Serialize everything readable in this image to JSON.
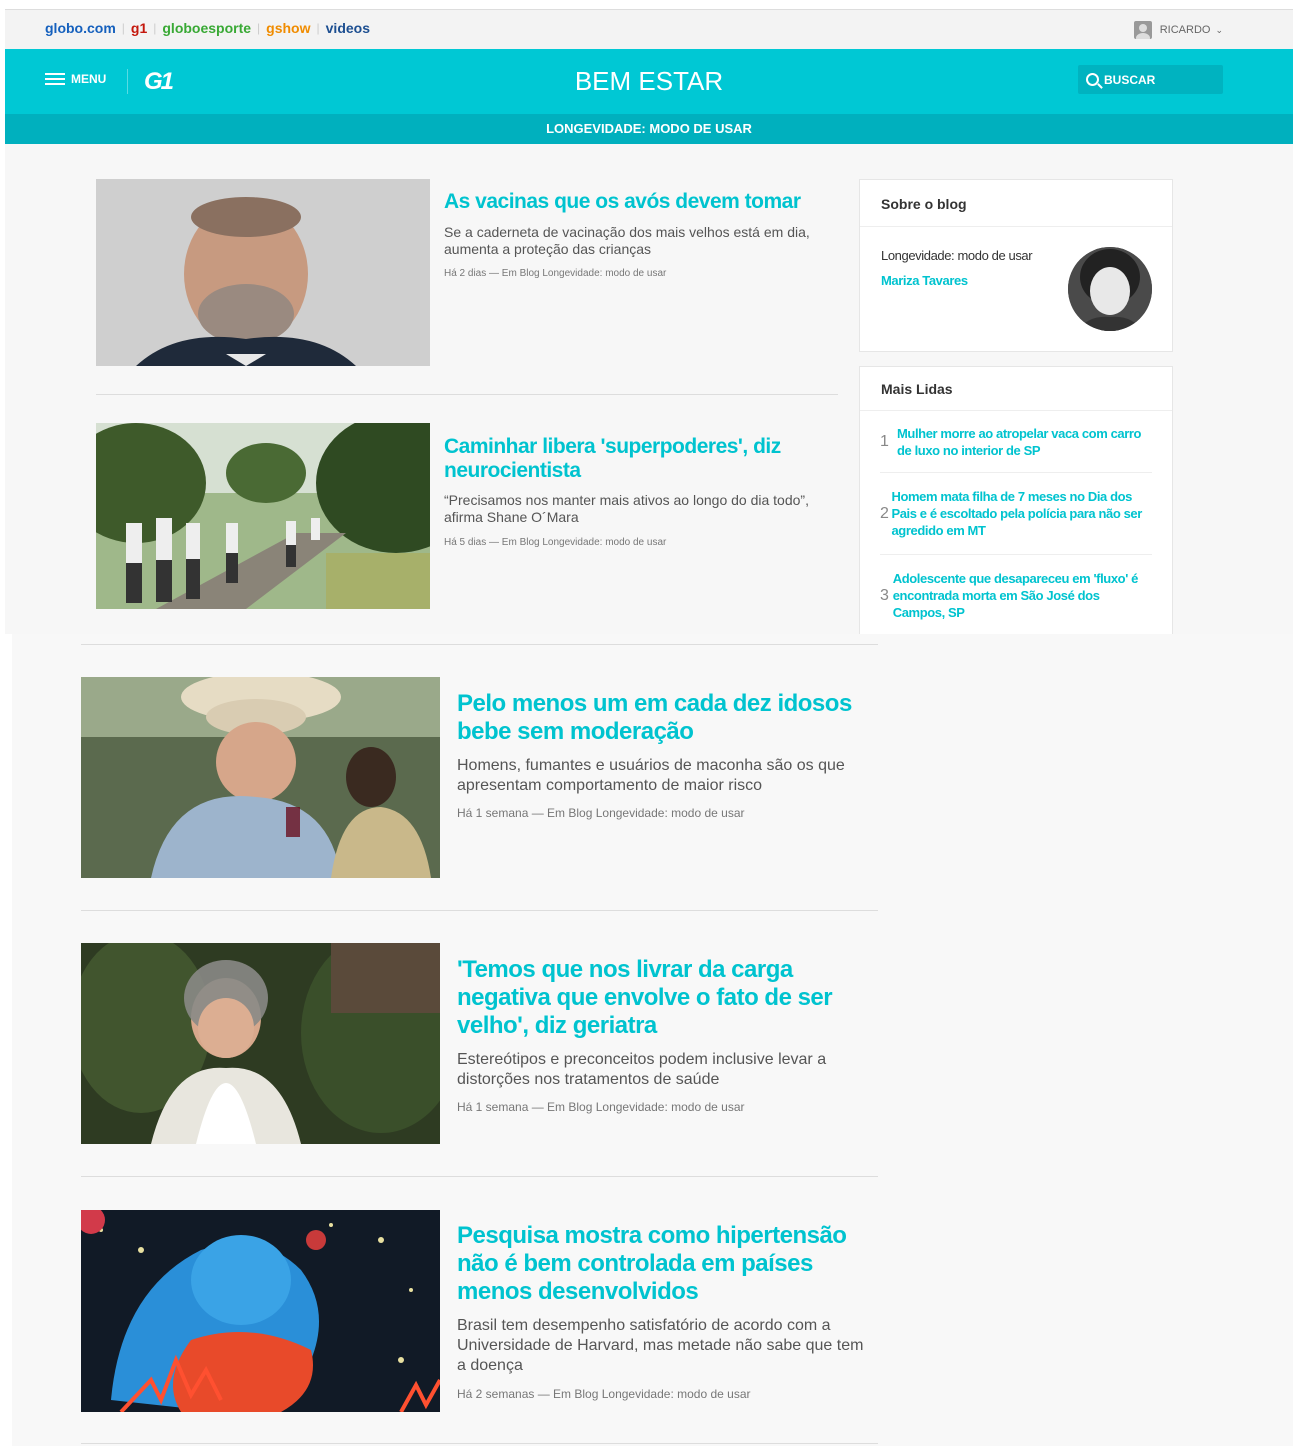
{
  "globo_bar": {
    "links": [
      {
        "label": "globo.com",
        "color": "#1560bd"
      },
      {
        "label": "g1",
        "color": "#c4170c"
      },
      {
        "label": "globoesporte",
        "color": "#39a935"
      },
      {
        "label": "gshow",
        "color": "#f08c00"
      },
      {
        "label": "videos",
        "color": "#1d4f91"
      }
    ],
    "user_name": "RICARDO"
  },
  "header": {
    "menu_label": "MENU",
    "logo": "G1",
    "title": "BEM ESTAR",
    "search_label": "BUSCAR",
    "subtitle": "LONGEVIDADE: MODO DE USAR",
    "accent": "#00c8d4"
  },
  "articles": [
    {
      "title": "As vacinas que os avós devem tomar",
      "description": "Se a caderneta de vacinação dos mais velhos está em dia, aumenta a proteção das crianças",
      "meta": "Há 2 dias — Em Blog Longevidade: modo de usar"
    },
    {
      "title": "Caminhar libera 'superpoderes', diz neurocientista",
      "description": "“Precisamos nos manter mais ativos ao longo do dia todo”, afirma Shane O´Mara",
      "meta": "Há 5 dias — Em Blog Longevidade: modo de usar"
    },
    {
      "title": "Pelo menos um em cada dez idosos bebe sem moderação",
      "description": "Homens, fumantes e usuários de maconha são os que apresentam comportamento de maior risco",
      "meta": "Há 1 semana — Em Blog Longevidade: modo de usar"
    },
    {
      "title": "'Temos que nos livrar da carga negativa que envolve o fato de ser velho', diz geriatra",
      "description": "Estereótipos e preconceitos podem inclusive levar a distorções nos tratamentos de saúde",
      "meta": "Há 1 semana — Em Blog Longevidade: modo de usar"
    },
    {
      "title": "Pesquisa mostra como hipertensão não é bem controlada em países menos desenvolvidos",
      "description": "Brasil tem desempenho satisfatório de acordo com a Universidade de Harvard, mas metade não sabe que tem a doença",
      "meta": "Há 2 semanas — Em Blog Longevidade: modo de usar"
    }
  ],
  "sidebar": {
    "about": {
      "heading": "Sobre o blog",
      "blog_name": "Longevidade: modo de usar",
      "author": "Mariza Tavares"
    },
    "most_read": {
      "heading": "Mais Lidas",
      "items": [
        {
          "num": "1",
          "title": "Mulher morre ao atropelar vaca com carro de luxo no interior de SP"
        },
        {
          "num": "2",
          "title": "Homem mata filha de 7 meses no Dia dos Pais e é escoltado pela polícia para não ser agredido em MT"
        },
        {
          "num": "3",
          "title": "Adolescente que desapareceu em 'fluxo' é encontrada morta em São José dos Campos, SP"
        }
      ]
    }
  }
}
